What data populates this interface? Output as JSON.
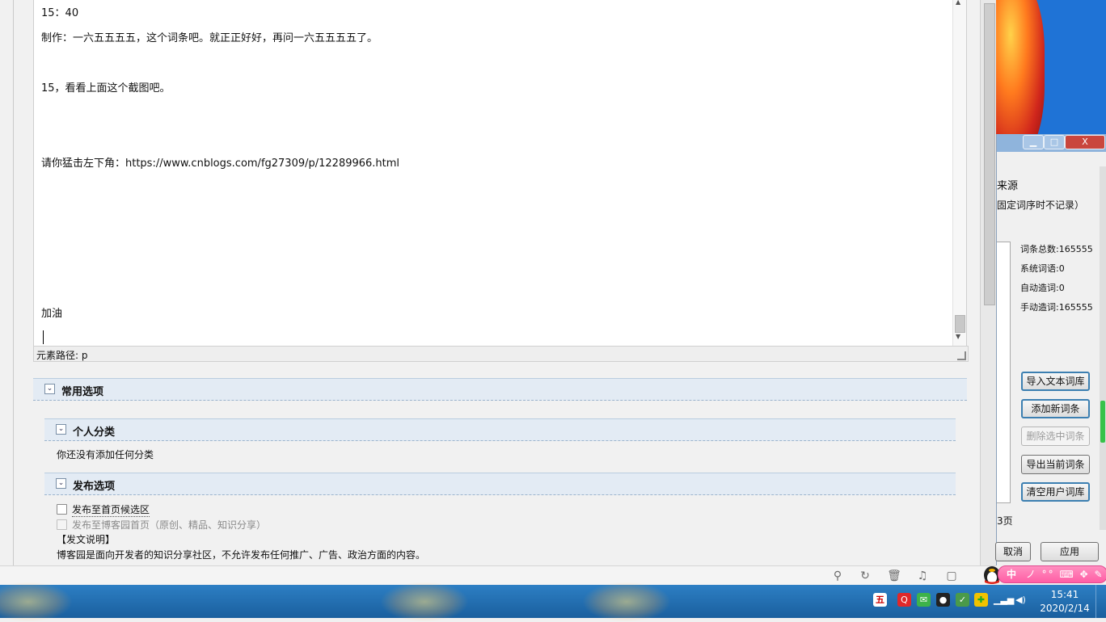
{
  "editor": {
    "lines": [
      "15：40",
      "制作：一六五五五五，这个词条吧。就正正好好，再问一六五五五五了。",
      "15，看看上面这个截图吧。",
      "请你猛击左下角：https://www.cnblogs.com/fg27309/p/12289966.html",
      "加油"
    ],
    "element_path": "元素路径: p"
  },
  "sections": {
    "common_options": "常用选项",
    "personal_category": {
      "title": "个人分类",
      "empty_text": "你还没有添加任何分类"
    },
    "publish_options": {
      "title": "发布选项",
      "checkbox_home_candidate": "发布至首页候选区",
      "checkbox_cnblogs_home": "发布至博客园首页（原创、精品、知识分享）",
      "notice_title": "【发文说明】",
      "notice_text": "博客园是面向开发者的知识分享社区，不允许发布任何推广、广告、政治方面的内容。"
    }
  },
  "dialog": {
    "window_buttons": {
      "minimize": "▁",
      "maximize": "□",
      "close": "X"
    },
    "partial_source": "来源",
    "partial_note": "固定词序时不记录）",
    "stats": {
      "total": "词条总数:165555",
      "system": "系统词语:0",
      "auto": "自动造词:0",
      "manual": "手动造词:165555"
    },
    "buttons": {
      "import": "导入文本词库",
      "add": "添加新词条",
      "delete": "删除选中词条",
      "export": "导出当前词条",
      "clear": "清空用户词库"
    },
    "partial_page": "3页",
    "cancel_partial": "取消",
    "apply": "应用"
  },
  "ime": {
    "label": "中",
    "icons": "ノ °° ⌨ ✥ ✎"
  },
  "taskbar": {
    "time": "15:41",
    "date": "2020/2/14"
  }
}
